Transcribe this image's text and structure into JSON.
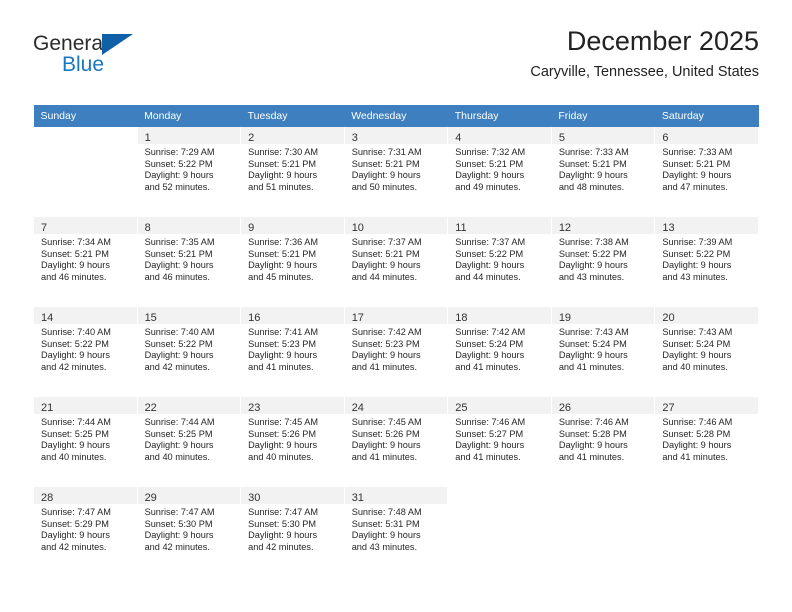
{
  "brand": {
    "name_part1": "General",
    "name_part2": "Blue",
    "accent_color": "#1878be",
    "triangle_color": "#1060a8"
  },
  "header": {
    "month_title": "December 2025",
    "location": "Caryville, Tennessee, United States"
  },
  "theme": {
    "header_bg": "#3d7fbf",
    "daynum_bg": "#f2f2f2",
    "text": "#262626"
  },
  "weekdays": [
    "Sunday",
    "Monday",
    "Tuesday",
    "Wednesday",
    "Thursday",
    "Friday",
    "Saturday"
  ],
  "weeks": [
    [
      {
        "day": "",
        "sunrise": "",
        "sunset": "",
        "daylight1": "",
        "daylight2": "",
        "empty": true
      },
      {
        "day": "1",
        "sunrise": "Sunrise: 7:29 AM",
        "sunset": "Sunset: 5:22 PM",
        "daylight1": "Daylight: 9 hours",
        "daylight2": "and 52 minutes."
      },
      {
        "day": "2",
        "sunrise": "Sunrise: 7:30 AM",
        "sunset": "Sunset: 5:21 PM",
        "daylight1": "Daylight: 9 hours",
        "daylight2": "and 51 minutes."
      },
      {
        "day": "3",
        "sunrise": "Sunrise: 7:31 AM",
        "sunset": "Sunset: 5:21 PM",
        "daylight1": "Daylight: 9 hours",
        "daylight2": "and 50 minutes."
      },
      {
        "day": "4",
        "sunrise": "Sunrise: 7:32 AM",
        "sunset": "Sunset: 5:21 PM",
        "daylight1": "Daylight: 9 hours",
        "daylight2": "and 49 minutes."
      },
      {
        "day": "5",
        "sunrise": "Sunrise: 7:33 AM",
        "sunset": "Sunset: 5:21 PM",
        "daylight1": "Daylight: 9 hours",
        "daylight2": "and 48 minutes."
      },
      {
        "day": "6",
        "sunrise": "Sunrise: 7:33 AM",
        "sunset": "Sunset: 5:21 PM",
        "daylight1": "Daylight: 9 hours",
        "daylight2": "and 47 minutes."
      }
    ],
    [
      {
        "day": "7",
        "sunrise": "Sunrise: 7:34 AM",
        "sunset": "Sunset: 5:21 PM",
        "daylight1": "Daylight: 9 hours",
        "daylight2": "and 46 minutes."
      },
      {
        "day": "8",
        "sunrise": "Sunrise: 7:35 AM",
        "sunset": "Sunset: 5:21 PM",
        "daylight1": "Daylight: 9 hours",
        "daylight2": "and 46 minutes."
      },
      {
        "day": "9",
        "sunrise": "Sunrise: 7:36 AM",
        "sunset": "Sunset: 5:21 PM",
        "daylight1": "Daylight: 9 hours",
        "daylight2": "and 45 minutes."
      },
      {
        "day": "10",
        "sunrise": "Sunrise: 7:37 AM",
        "sunset": "Sunset: 5:21 PM",
        "daylight1": "Daylight: 9 hours",
        "daylight2": "and 44 minutes."
      },
      {
        "day": "11",
        "sunrise": "Sunrise: 7:37 AM",
        "sunset": "Sunset: 5:22 PM",
        "daylight1": "Daylight: 9 hours",
        "daylight2": "and 44 minutes."
      },
      {
        "day": "12",
        "sunrise": "Sunrise: 7:38 AM",
        "sunset": "Sunset: 5:22 PM",
        "daylight1": "Daylight: 9 hours",
        "daylight2": "and 43 minutes."
      },
      {
        "day": "13",
        "sunrise": "Sunrise: 7:39 AM",
        "sunset": "Sunset: 5:22 PM",
        "daylight1": "Daylight: 9 hours",
        "daylight2": "and 43 minutes."
      }
    ],
    [
      {
        "day": "14",
        "sunrise": "Sunrise: 7:40 AM",
        "sunset": "Sunset: 5:22 PM",
        "daylight1": "Daylight: 9 hours",
        "daylight2": "and 42 minutes."
      },
      {
        "day": "15",
        "sunrise": "Sunrise: 7:40 AM",
        "sunset": "Sunset: 5:22 PM",
        "daylight1": "Daylight: 9 hours",
        "daylight2": "and 42 minutes."
      },
      {
        "day": "16",
        "sunrise": "Sunrise: 7:41 AM",
        "sunset": "Sunset: 5:23 PM",
        "daylight1": "Daylight: 9 hours",
        "daylight2": "and 41 minutes."
      },
      {
        "day": "17",
        "sunrise": "Sunrise: 7:42 AM",
        "sunset": "Sunset: 5:23 PM",
        "daylight1": "Daylight: 9 hours",
        "daylight2": "and 41 minutes."
      },
      {
        "day": "18",
        "sunrise": "Sunrise: 7:42 AM",
        "sunset": "Sunset: 5:24 PM",
        "daylight1": "Daylight: 9 hours",
        "daylight2": "and 41 minutes."
      },
      {
        "day": "19",
        "sunrise": "Sunrise: 7:43 AM",
        "sunset": "Sunset: 5:24 PM",
        "daylight1": "Daylight: 9 hours",
        "daylight2": "and 41 minutes."
      },
      {
        "day": "20",
        "sunrise": "Sunrise: 7:43 AM",
        "sunset": "Sunset: 5:24 PM",
        "daylight1": "Daylight: 9 hours",
        "daylight2": "and 40 minutes."
      }
    ],
    [
      {
        "day": "21",
        "sunrise": "Sunrise: 7:44 AM",
        "sunset": "Sunset: 5:25 PM",
        "daylight1": "Daylight: 9 hours",
        "daylight2": "and 40 minutes."
      },
      {
        "day": "22",
        "sunrise": "Sunrise: 7:44 AM",
        "sunset": "Sunset: 5:25 PM",
        "daylight1": "Daylight: 9 hours",
        "daylight2": "and 40 minutes."
      },
      {
        "day": "23",
        "sunrise": "Sunrise: 7:45 AM",
        "sunset": "Sunset: 5:26 PM",
        "daylight1": "Daylight: 9 hours",
        "daylight2": "and 40 minutes."
      },
      {
        "day": "24",
        "sunrise": "Sunrise: 7:45 AM",
        "sunset": "Sunset: 5:26 PM",
        "daylight1": "Daylight: 9 hours",
        "daylight2": "and 41 minutes."
      },
      {
        "day": "25",
        "sunrise": "Sunrise: 7:46 AM",
        "sunset": "Sunset: 5:27 PM",
        "daylight1": "Daylight: 9 hours",
        "daylight2": "and 41 minutes."
      },
      {
        "day": "26",
        "sunrise": "Sunrise: 7:46 AM",
        "sunset": "Sunset: 5:28 PM",
        "daylight1": "Daylight: 9 hours",
        "daylight2": "and 41 minutes."
      },
      {
        "day": "27",
        "sunrise": "Sunrise: 7:46 AM",
        "sunset": "Sunset: 5:28 PM",
        "daylight1": "Daylight: 9 hours",
        "daylight2": "and 41 minutes."
      }
    ],
    [
      {
        "day": "28",
        "sunrise": "Sunrise: 7:47 AM",
        "sunset": "Sunset: 5:29 PM",
        "daylight1": "Daylight: 9 hours",
        "daylight2": "and 42 minutes."
      },
      {
        "day": "29",
        "sunrise": "Sunrise: 7:47 AM",
        "sunset": "Sunset: 5:30 PM",
        "daylight1": "Daylight: 9 hours",
        "daylight2": "and 42 minutes."
      },
      {
        "day": "30",
        "sunrise": "Sunrise: 7:47 AM",
        "sunset": "Sunset: 5:30 PM",
        "daylight1": "Daylight: 9 hours",
        "daylight2": "and 42 minutes."
      },
      {
        "day": "31",
        "sunrise": "Sunrise: 7:48 AM",
        "sunset": "Sunset: 5:31 PM",
        "daylight1": "Daylight: 9 hours",
        "daylight2": "and 43 minutes."
      },
      {
        "day": "",
        "sunrise": "",
        "sunset": "",
        "daylight1": "",
        "daylight2": "",
        "empty": true
      },
      {
        "day": "",
        "sunrise": "",
        "sunset": "",
        "daylight1": "",
        "daylight2": "",
        "empty": true
      },
      {
        "day": "",
        "sunrise": "",
        "sunset": "",
        "daylight1": "",
        "daylight2": "",
        "empty": true
      }
    ]
  ]
}
